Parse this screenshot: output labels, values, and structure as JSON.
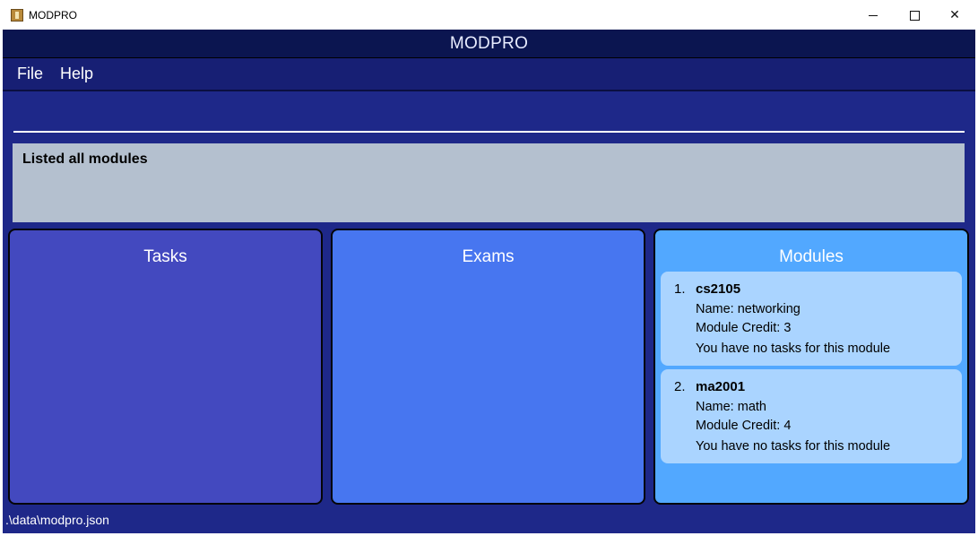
{
  "window": {
    "title": "MODPRO",
    "controls": {
      "minimize": "minimize",
      "maximize": "maximize",
      "close": "✕"
    }
  },
  "header": {
    "title": "MODPRO"
  },
  "menu": {
    "file": "File",
    "help": "Help"
  },
  "command_box": {
    "value": "",
    "placeholder": ""
  },
  "result": {
    "text": "Listed all modules"
  },
  "panels": {
    "tasks": {
      "title": "Tasks"
    },
    "exams": {
      "title": "Exams"
    },
    "modules": {
      "title": "Modules",
      "items": [
        {
          "index": "1.",
          "code": "cs2105",
          "name": "Name: networking",
          "credit": "Module Credit: 3",
          "tasks_note": "You have no tasks for this module"
        },
        {
          "index": "2.",
          "code": "ma2001",
          "name": "Name: math",
          "credit": "Module Credit: 4",
          "tasks_note": "You have no tasks for this module"
        }
      ]
    }
  },
  "status": {
    "path": ".\\data\\modpro.json"
  },
  "colors": {
    "app_background": "#1e2889",
    "header": "#0b1550",
    "menubar": "#171f74",
    "result_background": "#b4c0cf",
    "tasks_panel": "#4349bf",
    "exams_panel": "#4776f0",
    "modules_panel": "#52a8ff",
    "module_card": "#aad4ff"
  },
  "icons": {
    "app": "app-icon"
  }
}
